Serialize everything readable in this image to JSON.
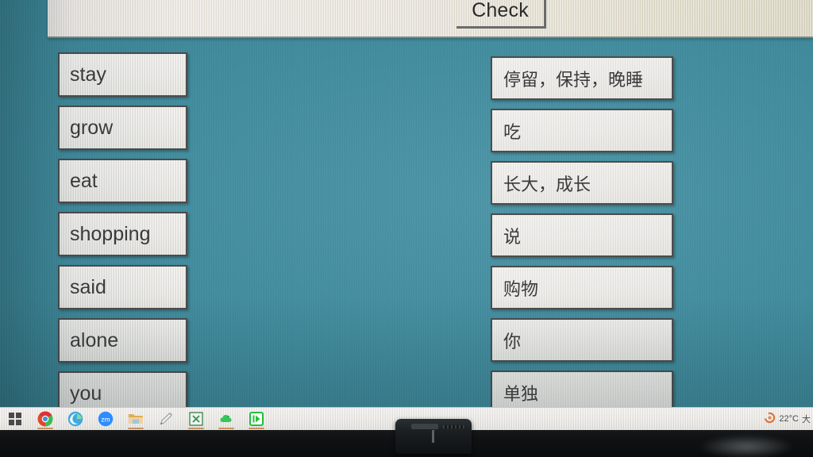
{
  "app": {
    "name": "vocabulary-matching-exercise",
    "background_color": "#3e8a9c",
    "toolbar_color": "#efeae3"
  },
  "toolbar": {
    "check_label": "Check"
  },
  "exercise": {
    "left_column": [
      {
        "label": "stay"
      },
      {
        "label": "grow"
      },
      {
        "label": "eat"
      },
      {
        "label": "shopping"
      },
      {
        "label": "said"
      },
      {
        "label": "alone"
      },
      {
        "label": "you"
      }
    ],
    "right_column": [
      {
        "label": "停留，保持，晚睡"
      },
      {
        "label": "吃"
      },
      {
        "label": "长大，成长"
      },
      {
        "label": "说"
      },
      {
        "label": "购物"
      },
      {
        "label": "你"
      },
      {
        "label": "单独"
      }
    ]
  },
  "taskbar": {
    "items": [
      {
        "icon": "windows-start-icon",
        "running": false
      },
      {
        "icon": "chrome-icon",
        "running": true
      },
      {
        "icon": "edge-icon",
        "running": false
      },
      {
        "icon": "zoom-icon",
        "running": false
      },
      {
        "icon": "file-explorer-icon",
        "running": true
      },
      {
        "icon": "whiteboard-pen-icon",
        "running": false
      },
      {
        "icon": "excel-icon",
        "running": true
      },
      {
        "icon": "green-cloud-app-icon",
        "running": true
      },
      {
        "icon": "media-player-icon",
        "running": true
      }
    ],
    "tray": {
      "weather_icon": "weather-partly-cloudy-icon",
      "temperature": "22°C",
      "condition_clipped": "大"
    }
  }
}
